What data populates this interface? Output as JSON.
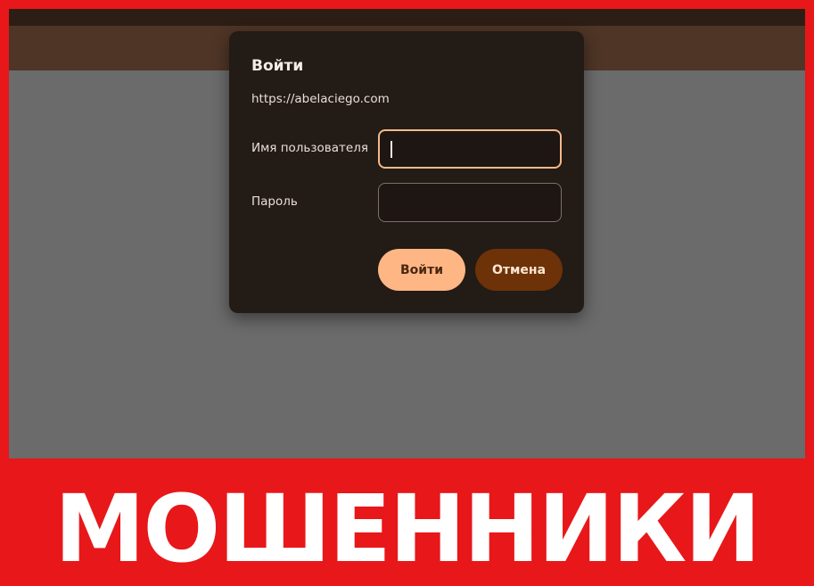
{
  "dialog": {
    "title": "Войти",
    "origin": "https://abelaciego.com",
    "username_label": "Имя пользователя",
    "username_value": "",
    "password_label": "Пароль",
    "password_value": "",
    "login_button": "Войти",
    "cancel_button": "Отмена"
  },
  "banner": {
    "text": "МОШЕННИКИ"
  },
  "colors": {
    "frame_red": "#e8171a",
    "dialog_bg": "#221b16",
    "accent_peach": "#ffb685",
    "cancel_brown": "#6e3208"
  }
}
